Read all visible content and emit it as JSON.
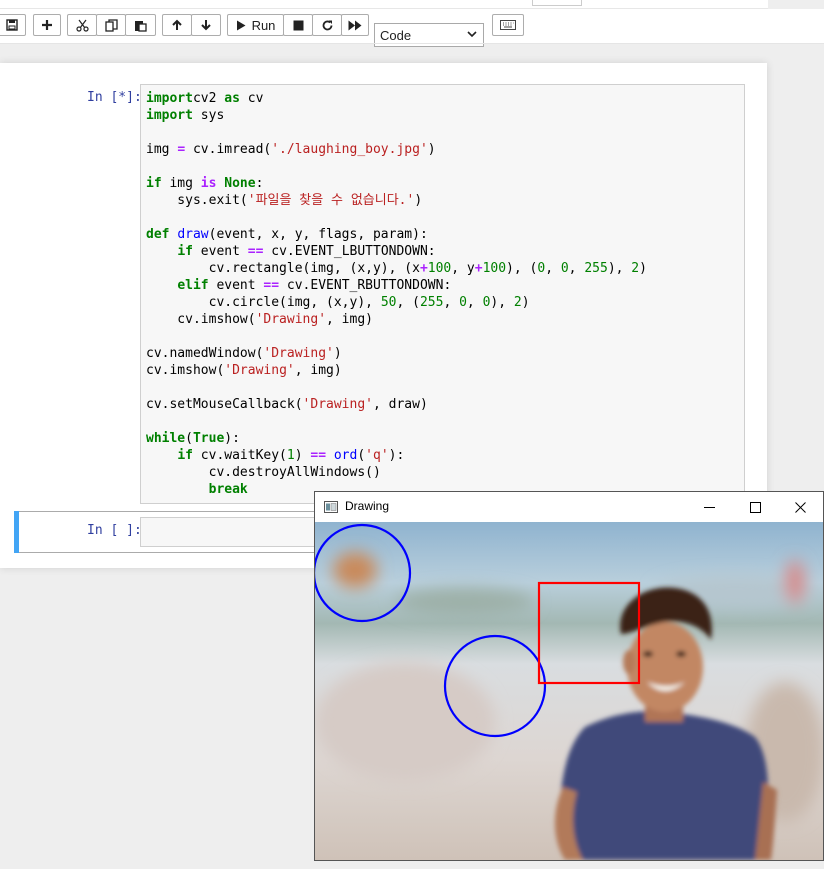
{
  "toolbar": {
    "run_label": "Run",
    "cell_type": "Code"
  },
  "cells": [
    {
      "prompt": "In [*]:",
      "code": [
        [
          [
            "kw",
            "import"
          ],
          [
            "",
            "cv2 "
          ],
          [
            "kw",
            "as"
          ],
          [
            "",
            " cv"
          ]
        ],
        [
          [
            "kw",
            "import"
          ],
          [
            "",
            " sys"
          ]
        ],
        [],
        [
          [
            "",
            "img "
          ],
          [
            "op",
            "="
          ],
          [
            "",
            " cv.imread("
          ],
          [
            "str",
            "'./laughing_boy.jpg'"
          ],
          [
            "",
            ")"
          ]
        ],
        [],
        [
          [
            "kw",
            "if"
          ],
          [
            "",
            " img "
          ],
          [
            "op",
            "is"
          ],
          [
            "",
            " "
          ],
          [
            "kw",
            "None"
          ],
          [
            "",
            ":"
          ]
        ],
        [
          [
            "",
            "    sys.exit("
          ],
          [
            "str",
            "'파일을 찾을 수 없습니다.'"
          ],
          [
            "",
            ")"
          ]
        ],
        [],
        [
          [
            "kw",
            "def"
          ],
          [
            "",
            " "
          ],
          [
            "fn",
            "draw"
          ],
          [
            "",
            "(event, x, y, flags, param):"
          ]
        ],
        [
          [
            "",
            "    "
          ],
          [
            "kw",
            "if"
          ],
          [
            "",
            " event "
          ],
          [
            "op",
            "=="
          ],
          [
            "",
            " cv.EVENT_LBUTTONDOWN:"
          ]
        ],
        [
          [
            "",
            "        cv.rectangle(img, (x,y), (x"
          ],
          [
            "op",
            "+"
          ],
          [
            "num",
            "100"
          ],
          [
            "",
            ", y"
          ],
          [
            "op",
            "+"
          ],
          [
            "num",
            "100"
          ],
          [
            "",
            "), ("
          ],
          [
            "num",
            "0"
          ],
          [
            "",
            ", "
          ],
          [
            "num",
            "0"
          ],
          [
            "",
            ", "
          ],
          [
            "num",
            "255"
          ],
          [
            "",
            "), "
          ],
          [
            "num",
            "2"
          ],
          [
            "",
            ")"
          ]
        ],
        [
          [
            "",
            "    "
          ],
          [
            "kw",
            "elif"
          ],
          [
            "",
            " event "
          ],
          [
            "op",
            "=="
          ],
          [
            "",
            " cv.EVENT_RBUTTONDOWN:"
          ]
        ],
        [
          [
            "",
            "        cv.circle(img, (x,y), "
          ],
          [
            "num",
            "50"
          ],
          [
            "",
            ", ("
          ],
          [
            "num",
            "255"
          ],
          [
            "",
            ", "
          ],
          [
            "num",
            "0"
          ],
          [
            "",
            ", "
          ],
          [
            "num",
            "0"
          ],
          [
            "",
            "), "
          ],
          [
            "num",
            "2"
          ],
          [
            "",
            ")"
          ]
        ],
        [
          [
            "",
            "    cv.imshow("
          ],
          [
            "str",
            "'Drawing'"
          ],
          [
            "",
            ", img)"
          ]
        ],
        [],
        [
          [
            "",
            "cv.namedWindow("
          ],
          [
            "str",
            "'Drawing'"
          ],
          [
            "",
            ")"
          ]
        ],
        [
          [
            "",
            "cv.imshow("
          ],
          [
            "str",
            "'Drawing'"
          ],
          [
            "",
            ", img)"
          ]
        ],
        [],
        [
          [
            "",
            "cv.setMouseCallback("
          ],
          [
            "str",
            "'Drawing'"
          ],
          [
            "",
            ", draw)"
          ]
        ],
        [],
        [
          [
            "kw",
            "while"
          ],
          [
            "",
            "("
          ],
          [
            "kw",
            "True"
          ],
          [
            "",
            "):"
          ]
        ],
        [
          [
            "",
            "    "
          ],
          [
            "kw",
            "if"
          ],
          [
            "",
            " cv.waitKey("
          ],
          [
            "num",
            "1"
          ],
          [
            "",
            ") "
          ],
          [
            "op",
            "=="
          ],
          [
            "",
            " "
          ],
          [
            "fn",
            "ord"
          ],
          [
            "",
            "("
          ],
          [
            "str",
            "'q'"
          ],
          [
            "",
            "):"
          ]
        ],
        [
          [
            "",
            "        cv.destroyAllWindows()"
          ]
        ],
        [
          [
            "",
            "        "
          ],
          [
            "kw",
            "break"
          ]
        ]
      ]
    },
    {
      "prompt": "In [ ]:",
      "code": []
    }
  ],
  "cv_window": {
    "title": "Drawing"
  },
  "colors": {
    "prompt": "#303f9f",
    "keyword": "#008000",
    "string": "#ba2121",
    "selected_cell": "#42a5f5",
    "circle": "#0000ff",
    "rectangle": "#ff0000"
  }
}
